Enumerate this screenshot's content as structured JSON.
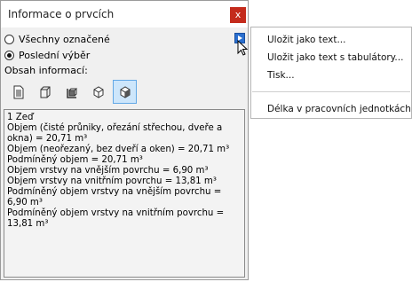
{
  "dialog": {
    "title": "Informace o prvcích",
    "close_glyph": "x"
  },
  "options": {
    "radio_all": {
      "label": "Všechny označené",
      "checked": false
    },
    "radio_last": {
      "label": "Poslední výběr",
      "checked": true
    }
  },
  "content_label": "Obsah informací:",
  "toolbar": {
    "buttons": [
      {
        "icon": "document-icon",
        "active": false
      },
      {
        "icon": "wall-outline-icon",
        "active": false
      },
      {
        "icon": "wall-layers-icon",
        "active": false
      },
      {
        "icon": "box-icon",
        "active": false
      },
      {
        "icon": "box-layered-icon",
        "active": true
      }
    ]
  },
  "info": {
    "lines": [
      "1 Zeď",
      "Objem (čisté průniky, ořezání střechou, dveře a",
      "okna) = 20,71 m³",
      "Objem (neořezaný, bez dveří a oken) = 20,71 m³",
      "Podmíněný objem = 20,71 m³",
      "Objem vrstvy na vnějším povrchu = 6,90 m³",
      "Objem vrstvy na vnitřním povrchu = 13,81 m³",
      "Podmíněný objem vrstvy na vnějším povrchu =",
      "6,90 m³",
      "Podmíněný objem vrstvy na vnitřním povrchu =",
      "13,81 m³"
    ]
  },
  "menu": {
    "items": [
      "Uložit jako text...",
      "Uložit jako text s tabulátory...",
      "Tisk...",
      "Délka v pracovních jednotkách"
    ]
  }
}
